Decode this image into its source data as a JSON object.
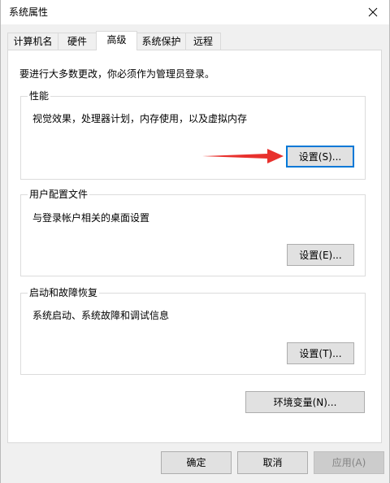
{
  "window": {
    "title": "系统属性"
  },
  "tabs": [
    {
      "label": "计算机名"
    },
    {
      "label": "硬件"
    },
    {
      "label": "高级"
    },
    {
      "label": "系统保护"
    },
    {
      "label": "远程"
    }
  ],
  "notice": "要进行大多数更改，你必须作为管理员登录。",
  "performance": {
    "title": "性能",
    "description": "视觉效果，处理器计划，内存使用，以及虚拟内存",
    "settings_label": "设置(S)..."
  },
  "user_profiles": {
    "title": "用户配置文件",
    "description": "与登录帐户相关的桌面设置",
    "settings_label": "设置(E)..."
  },
  "startup_recovery": {
    "title": "启动和故障恢复",
    "description": "系统启动、系统故障和调试信息",
    "settings_label": "设置(T)..."
  },
  "env_vars_label": "环境变量(N)...",
  "footer": {
    "ok_label": "确定",
    "cancel_label": "取消",
    "apply_label": "应用(A)"
  },
  "colors": {
    "accent": "#0078d7",
    "arrow": "#e8312d"
  }
}
